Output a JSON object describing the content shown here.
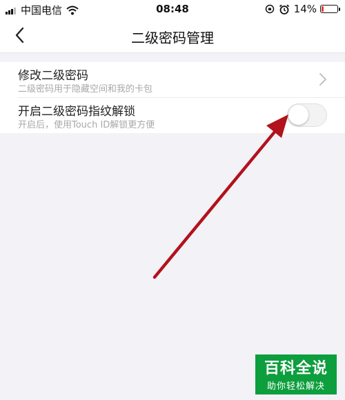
{
  "status_bar": {
    "carrier": "中国电信",
    "time": "08:48",
    "battery_percent": "14%",
    "battery_level": 0.14,
    "battery_color": "#e23c31"
  },
  "nav": {
    "title": "二级密码管理",
    "back_icon": "chevron-left-icon"
  },
  "settings": [
    {
      "title": "修改二级密码",
      "subtitle": "二级密码用于隐藏空间和我的卡包",
      "control": "chevron"
    },
    {
      "title": "开启二级密码指纹解锁",
      "subtitle": "开启后，使用Touch ID解锁更方便",
      "control": "toggle",
      "toggle_on": false
    }
  ],
  "annotation": {
    "arrow_color": "#b2121c"
  },
  "watermark": {
    "title": "百科全说",
    "subtitle": "助你轻松解决",
    "color": "#0d9e3e"
  }
}
